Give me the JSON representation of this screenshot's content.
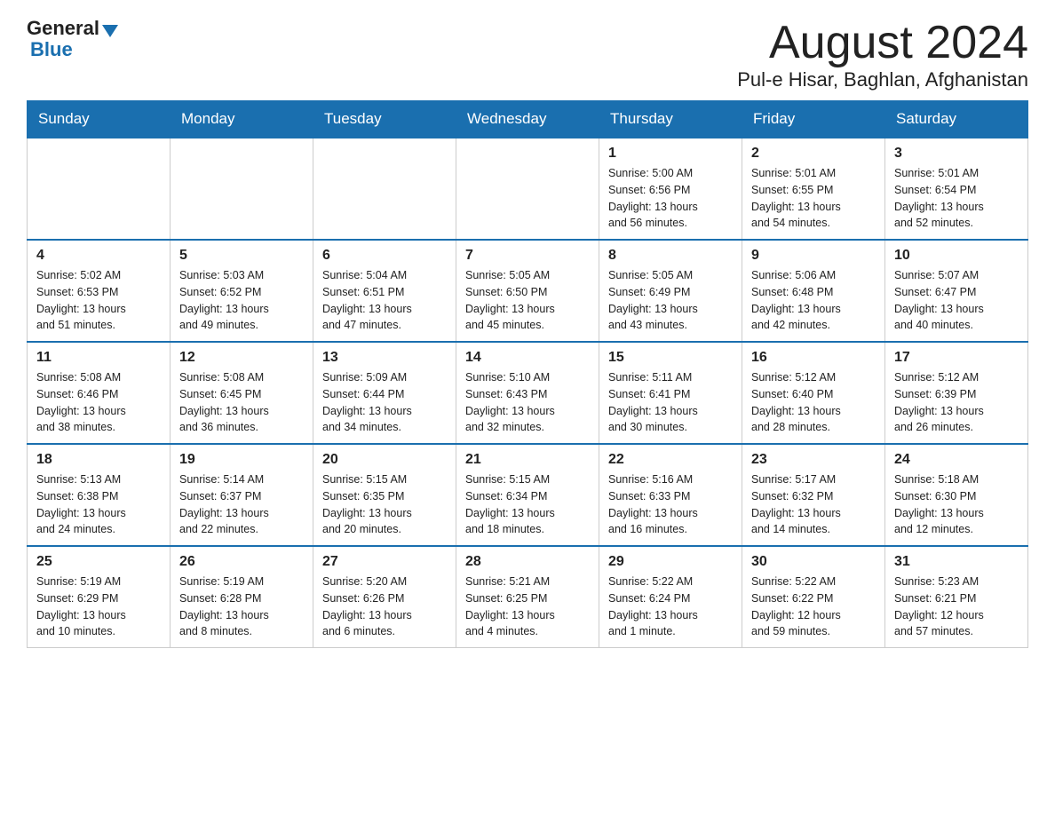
{
  "header": {
    "logo": {
      "general": "General",
      "triangle": "",
      "blue": "Blue"
    },
    "month_title": "August 2024",
    "location": "Pul-e Hisar, Baghlan, Afghanistan"
  },
  "weekdays": [
    "Sunday",
    "Monday",
    "Tuesday",
    "Wednesday",
    "Thursday",
    "Friday",
    "Saturday"
  ],
  "weeks": [
    [
      {
        "day": "",
        "info": ""
      },
      {
        "day": "",
        "info": ""
      },
      {
        "day": "",
        "info": ""
      },
      {
        "day": "",
        "info": ""
      },
      {
        "day": "1",
        "info": "Sunrise: 5:00 AM\nSunset: 6:56 PM\nDaylight: 13 hours\nand 56 minutes."
      },
      {
        "day": "2",
        "info": "Sunrise: 5:01 AM\nSunset: 6:55 PM\nDaylight: 13 hours\nand 54 minutes."
      },
      {
        "day": "3",
        "info": "Sunrise: 5:01 AM\nSunset: 6:54 PM\nDaylight: 13 hours\nand 52 minutes."
      }
    ],
    [
      {
        "day": "4",
        "info": "Sunrise: 5:02 AM\nSunset: 6:53 PM\nDaylight: 13 hours\nand 51 minutes."
      },
      {
        "day": "5",
        "info": "Sunrise: 5:03 AM\nSunset: 6:52 PM\nDaylight: 13 hours\nand 49 minutes."
      },
      {
        "day": "6",
        "info": "Sunrise: 5:04 AM\nSunset: 6:51 PM\nDaylight: 13 hours\nand 47 minutes."
      },
      {
        "day": "7",
        "info": "Sunrise: 5:05 AM\nSunset: 6:50 PM\nDaylight: 13 hours\nand 45 minutes."
      },
      {
        "day": "8",
        "info": "Sunrise: 5:05 AM\nSunset: 6:49 PM\nDaylight: 13 hours\nand 43 minutes."
      },
      {
        "day": "9",
        "info": "Sunrise: 5:06 AM\nSunset: 6:48 PM\nDaylight: 13 hours\nand 42 minutes."
      },
      {
        "day": "10",
        "info": "Sunrise: 5:07 AM\nSunset: 6:47 PM\nDaylight: 13 hours\nand 40 minutes."
      }
    ],
    [
      {
        "day": "11",
        "info": "Sunrise: 5:08 AM\nSunset: 6:46 PM\nDaylight: 13 hours\nand 38 minutes."
      },
      {
        "day": "12",
        "info": "Sunrise: 5:08 AM\nSunset: 6:45 PM\nDaylight: 13 hours\nand 36 minutes."
      },
      {
        "day": "13",
        "info": "Sunrise: 5:09 AM\nSunset: 6:44 PM\nDaylight: 13 hours\nand 34 minutes."
      },
      {
        "day": "14",
        "info": "Sunrise: 5:10 AM\nSunset: 6:43 PM\nDaylight: 13 hours\nand 32 minutes."
      },
      {
        "day": "15",
        "info": "Sunrise: 5:11 AM\nSunset: 6:41 PM\nDaylight: 13 hours\nand 30 minutes."
      },
      {
        "day": "16",
        "info": "Sunrise: 5:12 AM\nSunset: 6:40 PM\nDaylight: 13 hours\nand 28 minutes."
      },
      {
        "day": "17",
        "info": "Sunrise: 5:12 AM\nSunset: 6:39 PM\nDaylight: 13 hours\nand 26 minutes."
      }
    ],
    [
      {
        "day": "18",
        "info": "Sunrise: 5:13 AM\nSunset: 6:38 PM\nDaylight: 13 hours\nand 24 minutes."
      },
      {
        "day": "19",
        "info": "Sunrise: 5:14 AM\nSunset: 6:37 PM\nDaylight: 13 hours\nand 22 minutes."
      },
      {
        "day": "20",
        "info": "Sunrise: 5:15 AM\nSunset: 6:35 PM\nDaylight: 13 hours\nand 20 minutes."
      },
      {
        "day": "21",
        "info": "Sunrise: 5:15 AM\nSunset: 6:34 PM\nDaylight: 13 hours\nand 18 minutes."
      },
      {
        "day": "22",
        "info": "Sunrise: 5:16 AM\nSunset: 6:33 PM\nDaylight: 13 hours\nand 16 minutes."
      },
      {
        "day": "23",
        "info": "Sunrise: 5:17 AM\nSunset: 6:32 PM\nDaylight: 13 hours\nand 14 minutes."
      },
      {
        "day": "24",
        "info": "Sunrise: 5:18 AM\nSunset: 6:30 PM\nDaylight: 13 hours\nand 12 minutes."
      }
    ],
    [
      {
        "day": "25",
        "info": "Sunrise: 5:19 AM\nSunset: 6:29 PM\nDaylight: 13 hours\nand 10 minutes."
      },
      {
        "day": "26",
        "info": "Sunrise: 5:19 AM\nSunset: 6:28 PM\nDaylight: 13 hours\nand 8 minutes."
      },
      {
        "day": "27",
        "info": "Sunrise: 5:20 AM\nSunset: 6:26 PM\nDaylight: 13 hours\nand 6 minutes."
      },
      {
        "day": "28",
        "info": "Sunrise: 5:21 AM\nSunset: 6:25 PM\nDaylight: 13 hours\nand 4 minutes."
      },
      {
        "day": "29",
        "info": "Sunrise: 5:22 AM\nSunset: 6:24 PM\nDaylight: 13 hours\nand 1 minute."
      },
      {
        "day": "30",
        "info": "Sunrise: 5:22 AM\nSunset: 6:22 PM\nDaylight: 12 hours\nand 59 minutes."
      },
      {
        "day": "31",
        "info": "Sunrise: 5:23 AM\nSunset: 6:21 PM\nDaylight: 12 hours\nand 57 minutes."
      }
    ]
  ]
}
